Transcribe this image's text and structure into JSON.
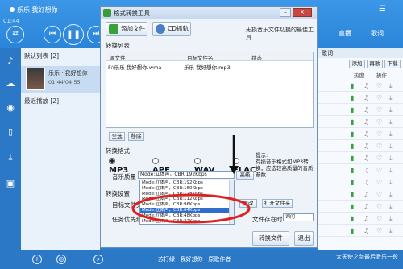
{
  "player": {
    "title": "乐乐  我好想你",
    "time": "01:44",
    "tabs": [
      "直播",
      "歌词"
    ],
    "playlist_header": "默认列表 [2]",
    "track_title": "乐乐 · 我好想你",
    "track_time": "01:44/04:55",
    "recent_header": "最近播放 [2]",
    "lyrics_label": "歌词",
    "right_buttons": [
      "添加",
      "再歌",
      "下载"
    ],
    "right_cols": [
      "热度",
      "操作"
    ],
    "bottom_artist": "苏打绿 · 我好想你 · 原歌作者",
    "watermark": "大天使之剑最后激乐一段"
  },
  "dialog": {
    "title": "格式转换工具",
    "add_file": "添加文件",
    "cd_grab": "CD抓轨",
    "slogan": "无损音乐文件切换的最佳工具",
    "list_label": "转换列表",
    "columns": [
      "源文件",
      "目标文件名",
      "状态"
    ],
    "rows": [
      {
        "src": "F:\\乐乐  我好想你.wma",
        "dst": "乐乐  我好想你.mp3",
        "status": ""
      }
    ],
    "select_all": "全选",
    "remove": "移除",
    "format_label": "转换格式",
    "formats": [
      {
        "label": "MP3",
        "checked": true
      },
      {
        "label": "APE",
        "checked": false
      },
      {
        "label": "WAV",
        "checked": false
      },
      {
        "label": "FLAC",
        "checked": false
      }
    ],
    "tip_title": "提示:",
    "tip_text": "有损音乐格式如MP3转换，应选较高质量的音质参数",
    "quality_label": "音乐质量",
    "quality_value": "Mode:立体声，CBR:192Kbps",
    "advanced": "高级",
    "settings_label": "转换设置",
    "target_label": "目标文件夹",
    "change": "更改",
    "open_folder": "打开文件夹",
    "priority_label": "任务优先级",
    "exists_label": "文件存在时",
    "exists_value": "询问",
    "convert": "转换文件",
    "exit": "退出",
    "quality_options": [
      "Mode:立体声，CBR:192Kbps",
      "Mode:立体声，CBR:160Kbps",
      "Mode:立体声，CBR:128Kbps",
      "Mode:立体声，CBR:112Kbps",
      "Mode:立体声，CBR:96Kbps",
      "Mode:立体声，CBR:64Kbps",
      "Mode:立体声，CBR:48Kbps",
      "Mode:立体声，CBR:32Kbps"
    ],
    "selected_option_index": 5
  },
  "colors": {
    "brand": "#2a84d8",
    "annotation": "#e02020",
    "selected": "#2f6fcb"
  }
}
